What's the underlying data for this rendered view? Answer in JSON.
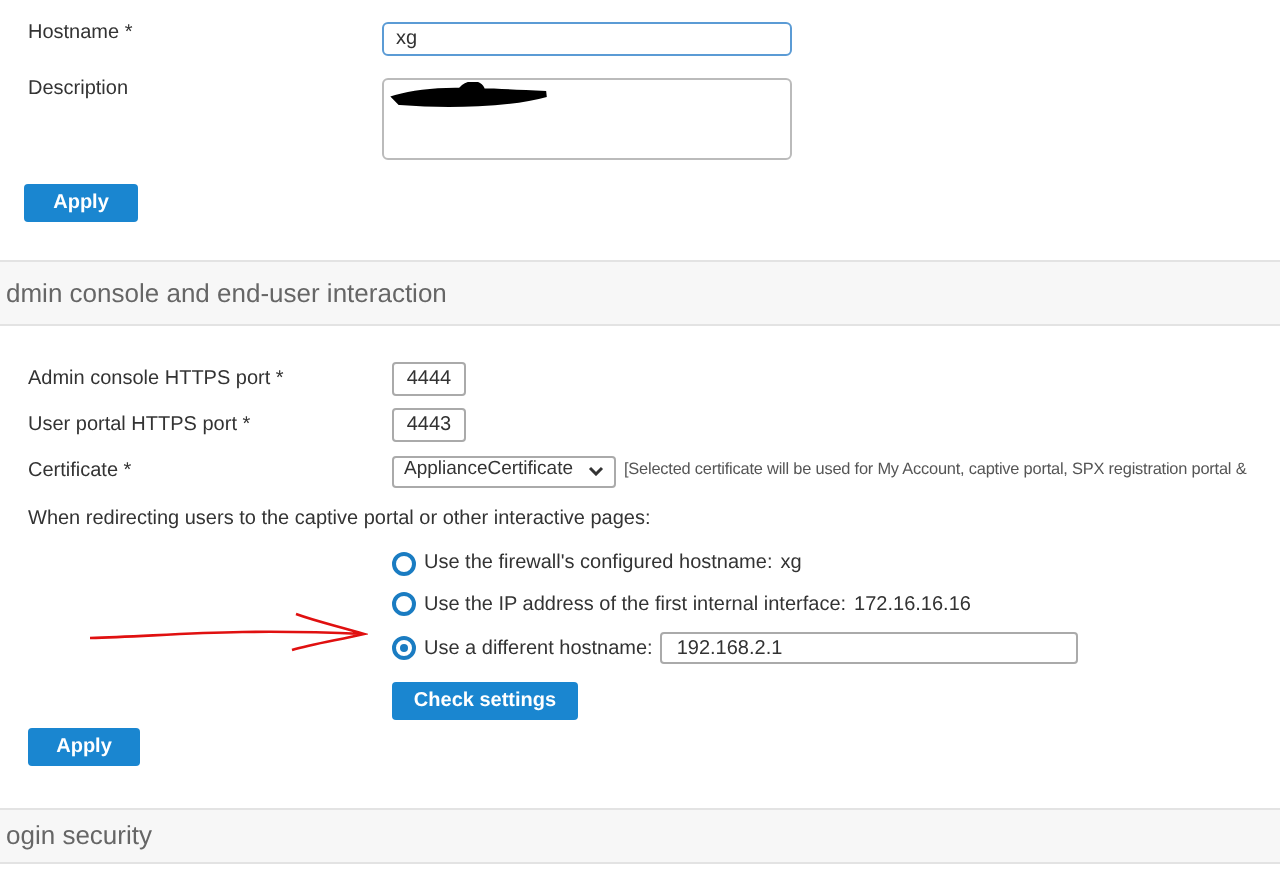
{
  "general": {
    "hostname_label": "Hostname *",
    "hostname_value": "xg",
    "description_label": "Description",
    "apply": "Apply"
  },
  "admin_section": {
    "title": "dmin console and end-user interaction",
    "admin_port_label": "Admin console HTTPS port *",
    "admin_port_value": "4444",
    "user_port_label": "User portal HTTPS port *",
    "user_port_value": "4443",
    "certificate_label": "Certificate *",
    "certificate_value": "ApplianceCertificate",
    "certificate_note": "[Selected certificate will be used for My Account, captive portal, SPX registration portal &",
    "redirect_label": "When redirecting users to the captive portal or other interactive pages:",
    "options": [
      {
        "kind": "text",
        "label": "Use the firewall's configured hostname:",
        "value": "xg",
        "selected": false
      },
      {
        "kind": "text",
        "label": "Use the IP address of the first internal interface:",
        "value": "172.16.16.16",
        "selected": false
      },
      {
        "kind": "input",
        "label": "Use a different hostname:",
        "value": "192.168.2.1",
        "selected": true
      }
    ],
    "check_settings": "Check settings",
    "apply": "Apply"
  },
  "login_section": {
    "title": "ogin security"
  }
}
